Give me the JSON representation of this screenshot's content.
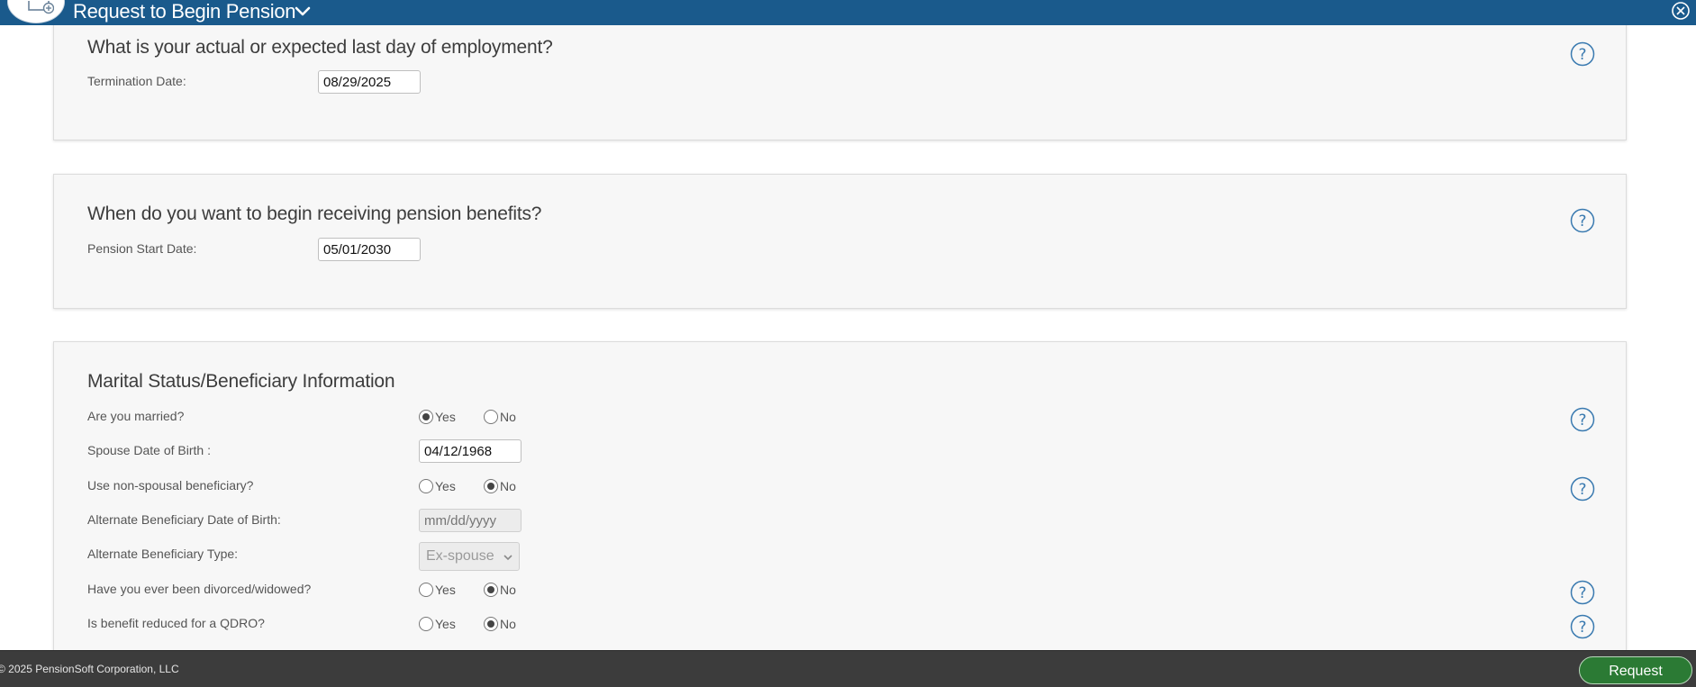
{
  "window": {
    "title": "Request to Begin Pension",
    "title_icon": "chevron-down-icon",
    "close_icon": "close-icon",
    "header_color": "#1a5a8c"
  },
  "sections": {
    "employment": {
      "title": "What is your actual or expected last day of employment?",
      "termination_label": "Termination Date:",
      "termination_value": "08/29/2025"
    },
    "start": {
      "title": "When do you want to begin receiving pension benefits?",
      "start_label": "Pension Start Date:",
      "start_value": "05/01/2030"
    },
    "marital": {
      "title": "Marital Status/Beneficiary Information",
      "married_label": "Are you married?",
      "married_selected": "Yes",
      "spouse_dob_label": "Spouse Date of Birth :",
      "spouse_dob_value": "04/12/1968",
      "non_spousal_label": "Use non-spousal beneficiary?",
      "non_spousal_selected": "No",
      "alt_dob_label": "Alternate Beneficiary Date of Birth:",
      "alt_dob_placeholder": "mm/dd/yyyy",
      "alt_type_label": "Alternate Beneficiary Type:",
      "alt_type_value": "Ex-spouse",
      "divorced_label": "Have you ever been divorced/widowed?",
      "divorced_selected": "No",
      "qdro_label": "Is benefit reduced for a QDRO?",
      "qdro_selected": "No",
      "yes_label": "Yes",
      "no_label": "No"
    }
  },
  "footer": {
    "copyright": "© 2025 PensionSoft Corporation, LLC",
    "request_label": "Request",
    "button_color": "#2b7a34"
  },
  "icons": {
    "help": "help-question-icon",
    "app": "document-add-icon"
  }
}
